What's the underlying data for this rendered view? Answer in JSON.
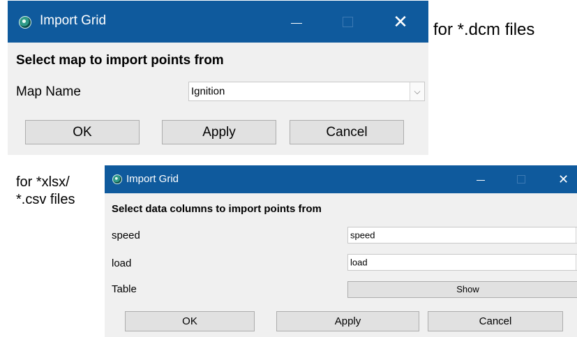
{
  "annotations": {
    "dcm_note": "for *.dcm files",
    "csv_note_line1": "for *xlsx/",
    "csv_note_line2": "*.csv files"
  },
  "dialog_dcm": {
    "title": "Import Grid",
    "heading": "Select map to import points from",
    "map_name_label": "Map Name",
    "map_name_value": "Ignition",
    "buttons": {
      "ok": "OK",
      "apply": "Apply",
      "cancel": "Cancel"
    }
  },
  "dialog_csv": {
    "title": "Import Grid",
    "heading": "Select data columns to import points from",
    "speed_label": "speed",
    "speed_value": "speed",
    "load_label": "load",
    "load_value": "load",
    "table_label": "Table",
    "show_button": "Show",
    "buttons": {
      "ok": "OK",
      "apply": "Apply",
      "cancel": "Cancel"
    }
  },
  "icons": {
    "app": "import-grid-app-icon",
    "minimize": "minimize-icon",
    "maximize": "maximize-icon",
    "close": "close-icon",
    "dropdown": "chevron-down-icon"
  },
  "colors": {
    "titlebar": "#0f5a9d",
    "dialog_bg": "#f0f0f0",
    "button_bg": "#e1e1e1"
  }
}
